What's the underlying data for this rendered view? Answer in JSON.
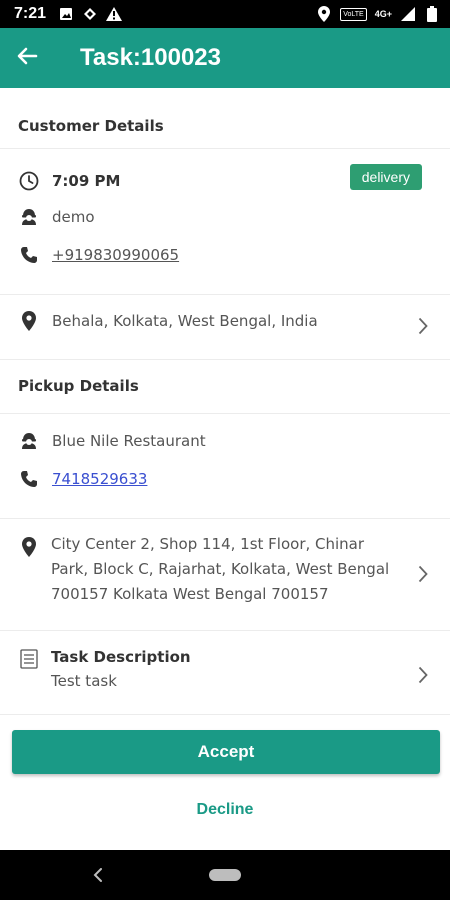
{
  "status_bar": {
    "time": "7:21",
    "network_tag": "VoLTE",
    "network_type": "4G+"
  },
  "app_bar": {
    "title": "Task:100023"
  },
  "customer": {
    "section_title": "Customer Details",
    "time": "7:09 PM",
    "badge": "delivery",
    "name": "demo",
    "phone": "+919830990065",
    "address": "Behala, Kolkata, West Bengal, India"
  },
  "pickup": {
    "section_title": "Pickup Details",
    "name": "Blue Nile Restaurant",
    "phone": "7418529633",
    "address": "City Center 2, Shop 114, 1st Floor, Chinar Park, Block C, Rajarhat, Kolkata, West Bengal 700157 Kolkata West Bengal 700157"
  },
  "task": {
    "title": "Task Description",
    "description": "Test task"
  },
  "actions": {
    "accept": "Accept",
    "decline": "Decline"
  },
  "colors": {
    "primary": "#1a9a86",
    "badge": "#2e9e72",
    "link_blue": "#3a4fd0"
  }
}
